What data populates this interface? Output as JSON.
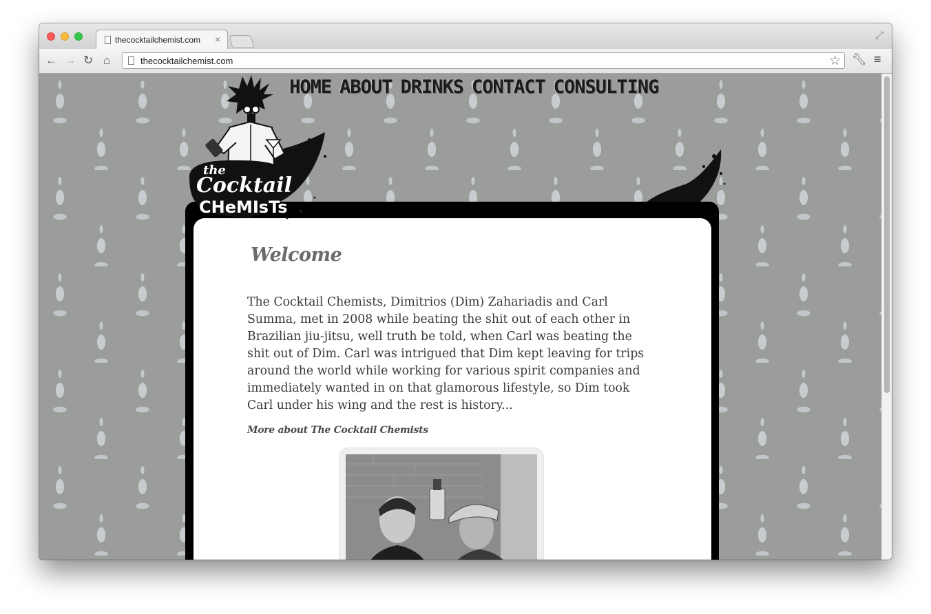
{
  "browser": {
    "tab_title": "thecocktailchemist.com",
    "tab_close": "×",
    "url": "thecocktailchemist.com"
  },
  "site": {
    "nav": [
      "HOME",
      "ABOUT",
      "DRINKS",
      "CONTACT",
      "CONSULTING"
    ],
    "logo_text": [
      "the",
      "Cocktail",
      "CHeMIsTs"
    ],
    "welcome_heading": "Welcome",
    "intro_paragraph": "The Cocktail Chemists, Dimitrios (Dim) Zahariadis and Carl Summa, met in 2008 while beating the shit out of each other in Brazilian jiu-jitsu, well truth be told, when Carl was beating the shit out of Dim. Carl was intrigued that Dim kept leaving for trips around the world while working for various spirit companies and immediately wanted in on that glamorous lifestyle, so Dim took Carl under his wing and the rest is history...",
    "more_link": "More about The Cocktail Chemists"
  },
  "colors": {
    "wallpaper": "#9a9d99",
    "frame": "#000000",
    "panel": "#ffffff",
    "heading": "#6b6b6b",
    "body_text": "#3a3a3a"
  },
  "icons": [
    "back-arrow-icon",
    "forward-arrow-icon",
    "reload-icon",
    "home-icon",
    "page-icon",
    "bookmark-star-icon",
    "wrench-icon",
    "menu-icon",
    "fullscreen-icon"
  ]
}
